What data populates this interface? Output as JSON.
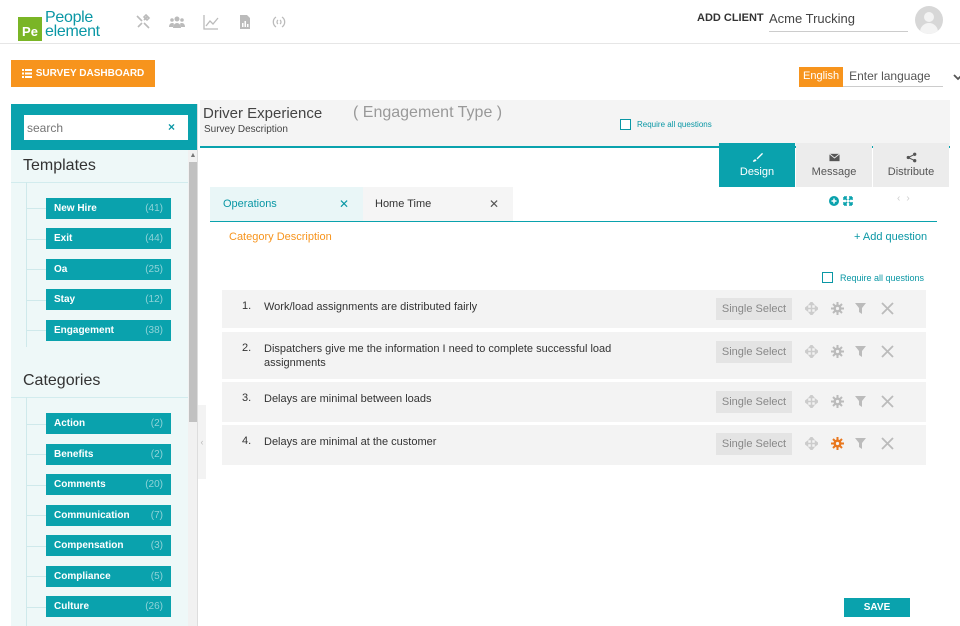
{
  "brand": {
    "line1": "People",
    "line2": "element",
    "mark": "Pe",
    "color": "#0a97a5",
    "mark_color": "#7ab526"
  },
  "topnav": {
    "icons": [
      "tools-icon",
      "users-icon",
      "chart-icon",
      "report-icon",
      "broadcast-icon"
    ],
    "add_client": "ADD CLIENT",
    "client": "Acme Trucking"
  },
  "dashboard_button": "SURVEY DASHBOARD",
  "language": {
    "selected": "English",
    "placeholder": "Enter language"
  },
  "sidebar": {
    "search_placeholder": "search",
    "clear_label": "×",
    "templates_title": "Templates",
    "templates": [
      {
        "label": "New Hire",
        "count": "(41)"
      },
      {
        "label": "Exit",
        "count": "(44)"
      },
      {
        "label": "Oa",
        "count": "(25)"
      },
      {
        "label": "Stay",
        "count": "(12)"
      },
      {
        "label": "Engagement",
        "count": "(38)"
      }
    ],
    "categories_title": "Categories",
    "categories": [
      {
        "label": "Action",
        "count": "(2)"
      },
      {
        "label": "Benefits",
        "count": "(2)"
      },
      {
        "label": "Comments",
        "count": "(20)"
      },
      {
        "label": "Communication",
        "count": "(7)"
      },
      {
        "label": "Compensation",
        "count": "(3)"
      },
      {
        "label": "Compliance",
        "count": "(5)"
      },
      {
        "label": "Culture",
        "count": "(26)"
      }
    ]
  },
  "survey": {
    "title": "Driver Experience",
    "description": "Survey Description",
    "engagement_type": "( Engagement Type )",
    "require_all": "Require all questions"
  },
  "mode_tabs": [
    {
      "label": "Design",
      "icon": "brush-icon",
      "active": true
    },
    {
      "label": "Message",
      "icon": "envelope-icon",
      "active": false
    },
    {
      "label": "Distribute",
      "icon": "share-icon",
      "active": false
    }
  ],
  "category_tabs": [
    {
      "label": "Operations",
      "close": "✕"
    },
    {
      "label": "Home Time",
      "close": "✕"
    }
  ],
  "category_description": "Category Description",
  "add_question": "+ Add question",
  "require_all_questions": "Require all questions",
  "questions": [
    {
      "num": "1.",
      "text": "Work/load assignments are distributed fairly",
      "type": "Single Select"
    },
    {
      "num": "2.",
      "text": "Dispatchers give me the information I need to complete successful load assignments",
      "type": "Single Select"
    },
    {
      "num": "3.",
      "text": "Delays are minimal between loads",
      "type": "Single Select"
    },
    {
      "num": "4.",
      "text": "Delays are minimal at the customer",
      "type": "Single Select"
    }
  ],
  "save_label": "SAVE",
  "colors": {
    "accent": "#0aa2ad",
    "orange": "#f7941d"
  }
}
